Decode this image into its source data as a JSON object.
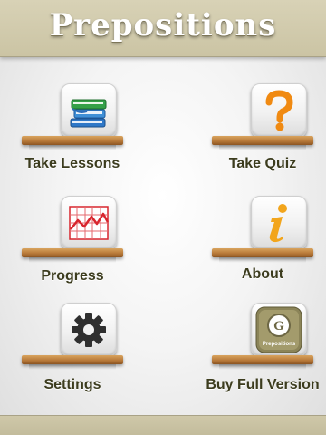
{
  "header": {
    "title": "Prepositions"
  },
  "menu": [
    {
      "label": "Take Lessons",
      "icon": "books-icon"
    },
    {
      "label": "Take Quiz",
      "icon": "question-mark-icon"
    },
    {
      "label": "Progress",
      "icon": "line-chart-icon"
    },
    {
      "label": "About",
      "icon": "info-icon"
    },
    {
      "label": "Settings",
      "icon": "gear-icon"
    },
    {
      "label": "Buy Full Version",
      "icon": "app-logo-icon"
    }
  ],
  "logo": {
    "letter": "G",
    "caption": "Prepositions"
  },
  "colors": {
    "header_bg": "#cbc4a4",
    "title_text": "#ffffff",
    "label_text": "#3c3c1e",
    "shelf_wood": "#b97a3a",
    "question_orange": "#f08a12",
    "info_orange": "#f2a51c",
    "chart_red": "#d8262e"
  }
}
